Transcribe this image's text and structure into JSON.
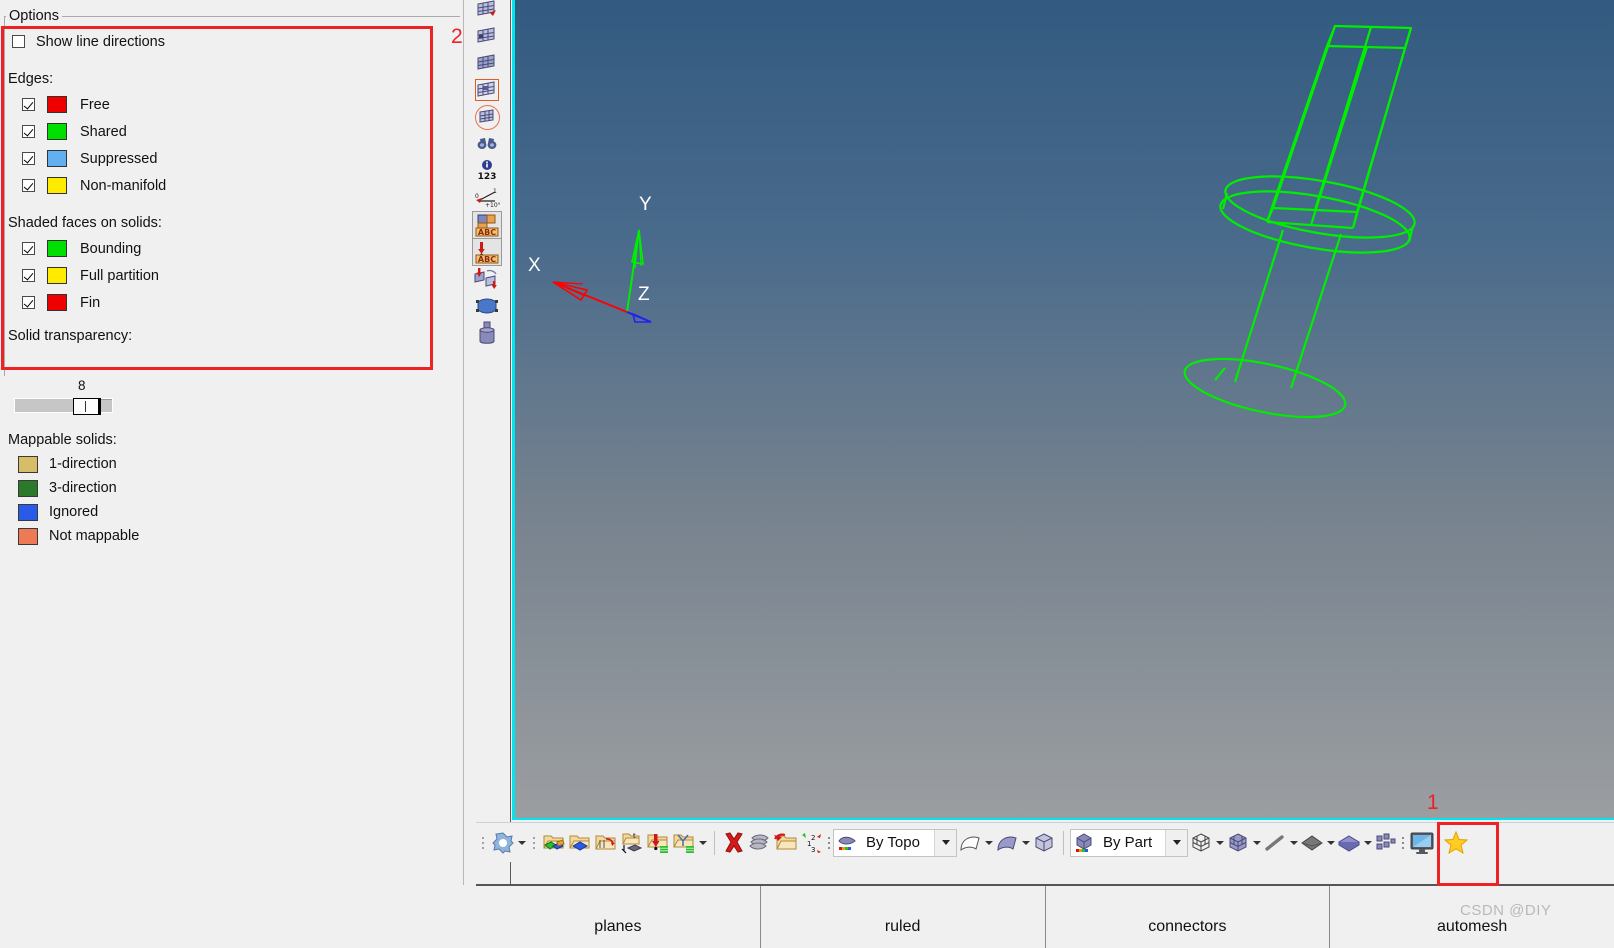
{
  "panel": {
    "groupbox_title": "Options",
    "show_line_directions": {
      "label": "Show line directions",
      "checked": false
    },
    "edges_header": "Edges:",
    "edges": [
      {
        "label": "Free",
        "color": "#ee0000",
        "checked": true
      },
      {
        "label": "Shared",
        "color": "#00e000",
        "checked": true
      },
      {
        "label": "Suppressed",
        "color": "#63b0f0",
        "checked": true
      },
      {
        "label": "Non-manifold",
        "color": "#ffeb00",
        "checked": true
      }
    ],
    "shaded_header": "Shaded faces on solids:",
    "shaded_faces": [
      {
        "label": "Bounding",
        "color": "#00e000",
        "checked": true
      },
      {
        "label": "Full partition",
        "color": "#ffeb00",
        "checked": true
      },
      {
        "label": "Fin",
        "color": "#ee0000",
        "checked": true
      }
    ],
    "transparency": {
      "label": "Solid transparency:",
      "value": "8",
      "min": 0,
      "max": 10
    },
    "mappable_header": "Mappable solids:",
    "mappable_solids": [
      {
        "label": "1-direction",
        "color": "#d8bd69"
      },
      {
        "label": "3-direction",
        "color": "#2b7a2b"
      },
      {
        "label": "Ignored",
        "color": "#2a5ae8"
      },
      {
        "label": "Not mappable",
        "color": "#ec7a55"
      }
    ]
  },
  "annotations": [
    {
      "number": "1",
      "target": "display-monitor-toolbar-button"
    },
    {
      "number": "2",
      "target": "options-group-box"
    }
  ],
  "vertical_toolbar": {
    "items": [
      {
        "name": "mesh-edit-icon",
        "state": "normal"
      },
      {
        "name": "mesh-quality-icon",
        "state": "normal"
      },
      {
        "name": "mesh-grid-icon",
        "state": "normal"
      },
      {
        "name": "mesh-element-icon",
        "state": "highlighted"
      },
      {
        "name": "mesh-circle-icon",
        "state": "circled"
      },
      {
        "name": "binoculars-icon",
        "state": "normal"
      },
      {
        "name": "info-123-icon",
        "state": "normal"
      },
      {
        "name": "measure-angle-icon",
        "state": "normal"
      },
      {
        "name": "abc-label-icon",
        "state": "selected"
      },
      {
        "name": "abc-arrow-label-icon",
        "state": "selected"
      },
      {
        "name": "translate-copy-icon",
        "state": "normal"
      },
      {
        "name": "surface-patch-icon",
        "state": "normal"
      },
      {
        "name": "cylinder-solid-icon",
        "state": "normal"
      }
    ]
  },
  "viewport": {
    "axes": {
      "x": "X",
      "y": "Y",
      "z": "Z",
      "x_color": "#ff0000",
      "y_color": "#00ee00",
      "z_color": "#2222ee"
    },
    "model_color": "#00ee00",
    "bg_top": "#325a80",
    "bg_bottom": "#9b9ea1",
    "border_color": "#00e5ee"
  },
  "bottom_toolbar": {
    "groups": [
      {
        "icons": [
          {
            "name": "mesh-node-icon",
            "caret": true
          }
        ]
      },
      {
        "icons": [
          {
            "name": "geom-folder-green-icon",
            "caret": false
          },
          {
            "name": "geom-folder-blue-icon",
            "caret": false
          },
          {
            "name": "folder-hidden-icon",
            "caret": false
          },
          {
            "name": "folder-t-icon",
            "caret": false
          },
          {
            "name": "folder-down-arrow-icon",
            "caret": false
          },
          {
            "name": "folder-tree-icon",
            "caret": true
          }
        ]
      },
      {
        "icons": [
          {
            "name": "delete-x-icon",
            "caret": false
          },
          {
            "name": "stack-layers-icon",
            "caret": false
          },
          {
            "name": "folder-import-icon",
            "caret": false
          },
          {
            "name": "reorder-123-icon",
            "caret": false
          }
        ]
      }
    ],
    "topo_combo": {
      "label": "By Topo",
      "icon": "topo-icon"
    },
    "shape_icons": [
      {
        "name": "arc-shape-icon",
        "caret": true
      },
      {
        "name": "surface-shape-icon",
        "caret": true
      },
      {
        "name": "cube-shape-icon",
        "caret": false
      }
    ],
    "part_combo": {
      "label": "By Part",
      "icon": "part-cube-icon"
    },
    "display_icons": [
      {
        "name": "wireframe-cube-icon",
        "caret": true
      },
      {
        "name": "shaded-cube-icon",
        "caret": true
      },
      {
        "name": "line-element-icon",
        "caret": true
      },
      {
        "name": "shell-element-icon",
        "caret": true
      },
      {
        "name": "solid-element-icon",
        "caret": true
      },
      {
        "name": "mesh-blocks-icon",
        "caret": false
      }
    ],
    "monitor_button": {
      "name": "display-monitor-icon",
      "highlighted": true
    },
    "star_button": {
      "name": "favorites-star-icon"
    }
  },
  "tabs": [
    {
      "label": "planes"
    },
    {
      "label": "ruled"
    },
    {
      "label": "connectors"
    },
    {
      "label": "automesh"
    }
  ],
  "watermark": "CSDN @DIY"
}
